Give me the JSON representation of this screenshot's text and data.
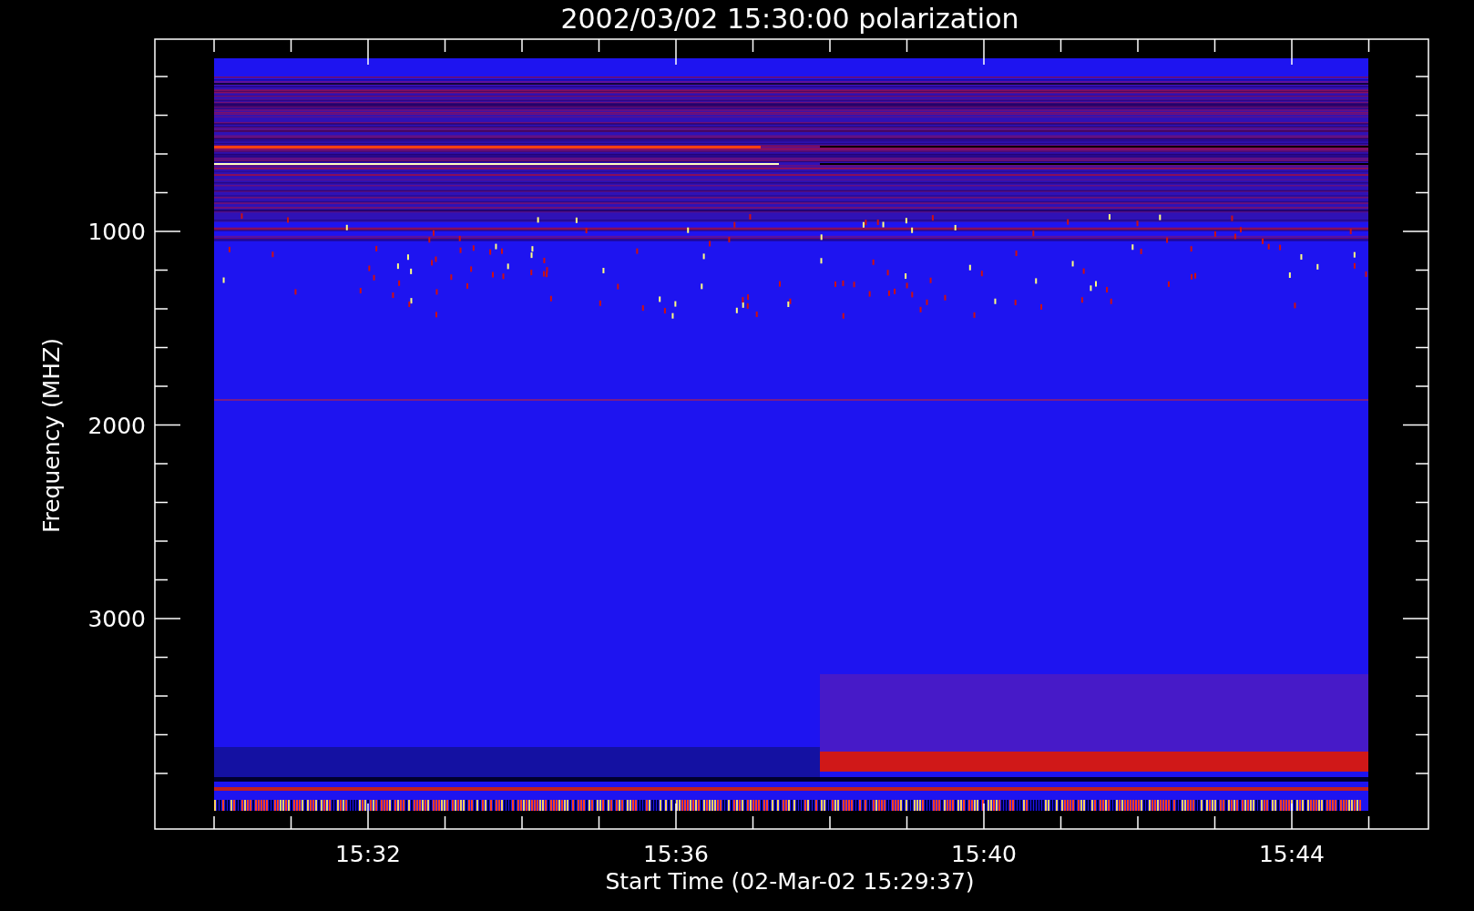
{
  "title": "2002/03/02 15:30:00 polarization",
  "y_axis": {
    "label": "Frequency (MHZ)",
    "ticks": [
      "1000",
      "2000",
      "3000"
    ]
  },
  "x_axis": {
    "label": "Start Time (02-Mar-02 15:29:37)",
    "ticks": [
      "15:32",
      "15:36",
      "15:40",
      "15:44"
    ]
  }
}
